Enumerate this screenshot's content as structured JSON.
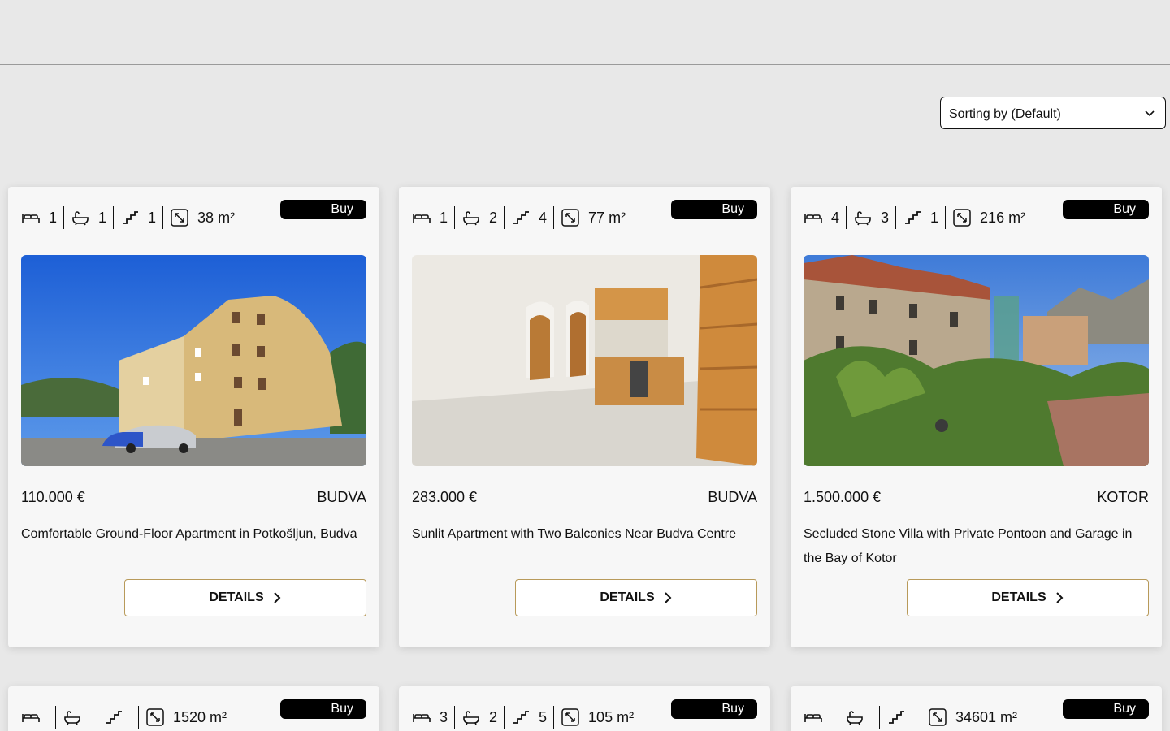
{
  "sort": {
    "label": "Sorting by (Default)"
  },
  "cards": [
    {
      "beds": "1",
      "baths": "1",
      "floors": "1",
      "area": "38 m²",
      "deal": "Buy",
      "price": "110.000 €",
      "city": "BUDVA",
      "title": "Comfortable Ground-Floor Apartment in Potkošljun, Budva",
      "details": "DETAILS"
    },
    {
      "beds": "1",
      "baths": "2",
      "floors": "4",
      "area": "77 m²",
      "deal": "Buy",
      "price": "283.000 €",
      "city": "BUDVA",
      "title": "Sunlit Apartment with Two Balconies Near Budva Centre",
      "details": "DETAILS"
    },
    {
      "beds": "4",
      "baths": "3",
      "floors": "1",
      "area": "216 m²",
      "deal": "Buy",
      "price": "1.500.000 €",
      "city": "KOTOR",
      "title": "Secluded Stone Villa with Private Pontoon and Garage in the Bay of Kotor",
      "details": "DETAILS"
    },
    {
      "beds": "",
      "baths": "",
      "floors": "",
      "area": "1520 m²",
      "deal": "Buy"
    },
    {
      "beds": "3",
      "baths": "2",
      "floors": "5",
      "area": "105 m²",
      "deal": "Buy"
    },
    {
      "beds": "",
      "baths": "",
      "floors": "",
      "area": "34601 m²",
      "deal": "Buy"
    }
  ]
}
